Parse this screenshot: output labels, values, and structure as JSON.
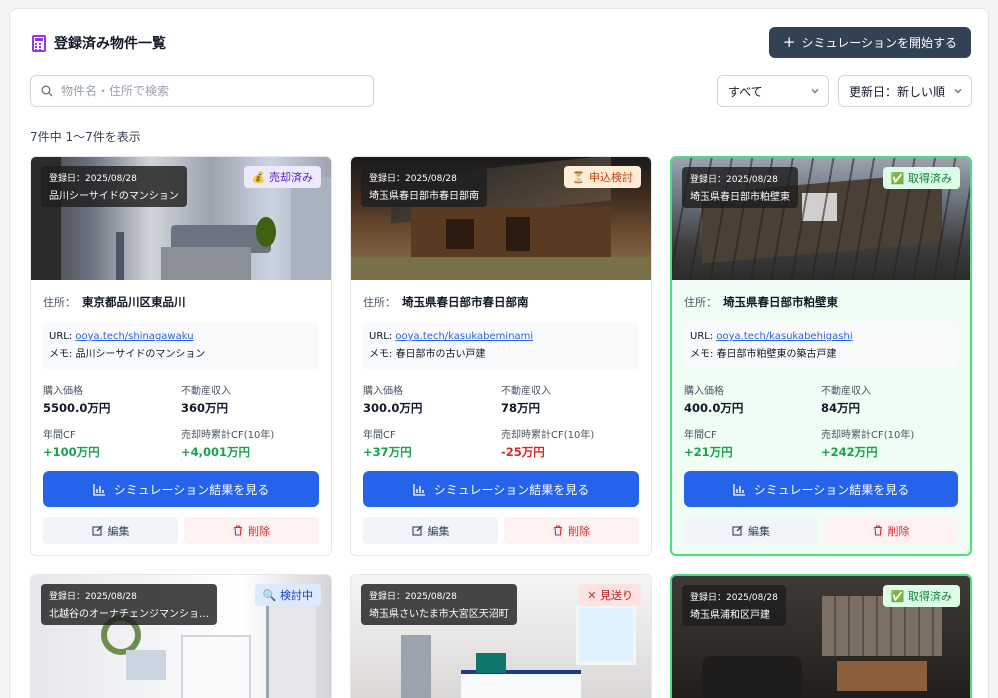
{
  "header": {
    "title": "登録済み物件一覧",
    "start_button": "シミュレーションを開始する"
  },
  "search": {
    "placeholder": "物件名・住所で検索",
    "value": ""
  },
  "filters": {
    "status": "すべて",
    "sort": "更新日：新しい順"
  },
  "count_text": "7件中 1〜7件を表示",
  "labels": {
    "address": "住所：",
    "url": "URL:",
    "memo": "メモ:",
    "price": "購入価格",
    "income": "不動産収入",
    "annual_cf": "年間CF",
    "sale_cf": "売却時累計CF(10年)",
    "sim_button": "シミュレーション結果を見る",
    "edit": "編集",
    "delete": "削除"
  },
  "colors": {
    "accent": "#2563eb",
    "positive": "#16a34a",
    "negative": "#dc2626",
    "highlight_border": "#4ade80"
  },
  "cards": [
    {
      "date": "登録日：2025/08/28",
      "name": "品川シーサイドのマンション",
      "status_icon": "money-bag-icon",
      "status": "売却済み",
      "address": "東京都品川区東品川",
      "url": "ooya.tech/shinagawaku",
      "memo": "品川シーサイドのマンション",
      "price": "5500.0万円",
      "income": "360万円",
      "annual_cf": "+100万円",
      "sale_cf": "+4,001万円"
    },
    {
      "date": "登録日：2025/08/28",
      "name": "埼玉県春日部市春日部南",
      "status_icon": "hourglass-icon",
      "status": "申込検討",
      "address": "埼玉県春日部市春日部南",
      "url": "ooya.tech/kasukabeminami",
      "memo": "春日部市の古い戸建",
      "price": "300.0万円",
      "income": "78万円",
      "annual_cf": "+37万円",
      "sale_cf": "-25万円"
    },
    {
      "date": "登録日：2025/08/28",
      "name": "埼玉県春日部市粕壁東",
      "status_icon": "check-icon",
      "status": "取得済み",
      "address": "埼玉県春日部市粕壁東",
      "url": "ooya.tech/kasukabehigashi",
      "memo": "春日部市粕壁東の築古戸建",
      "price": "400.0万円",
      "income": "84万円",
      "annual_cf": "+21万円",
      "sale_cf": "+242万円"
    },
    {
      "date": "登録日：2025/08/28",
      "name": "北越谷のオーナチェンジマンショ…",
      "status_icon": "magnifier-icon",
      "status": "検討中"
    },
    {
      "date": "登録日：2025/08/28",
      "name": "埼玉県さいたま市大宮区天沼町",
      "status_icon": "cross-icon",
      "status": "見送り"
    },
    {
      "date": "登録日：2025/08/28",
      "name": "埼玉県浦和区戸建",
      "status_icon": "check-icon",
      "status": "取得済み"
    }
  ]
}
